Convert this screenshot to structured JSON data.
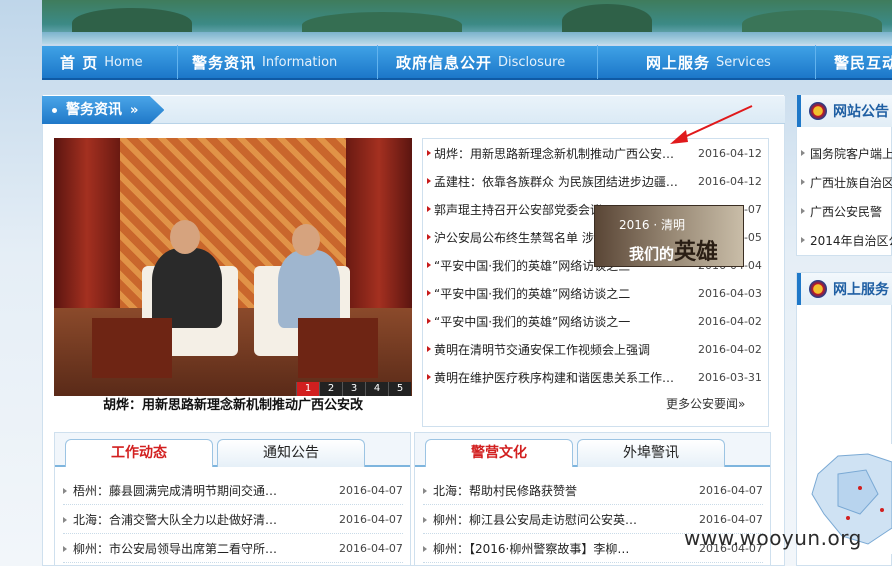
{
  "nav": {
    "items": [
      {
        "zh": "首 页",
        "en": "Home"
      },
      {
        "zh": "警务资讯",
        "en": "Information"
      },
      {
        "zh": "政府信息公开",
        "en": "Disclosure"
      },
      {
        "zh": "网上服务",
        "en": "Services"
      },
      {
        "zh": "警民互动",
        "en": ""
      }
    ]
  },
  "section": {
    "title": "警务资讯",
    "chevrons": "»"
  },
  "photo": {
    "caption": "胡烨：用新思路新理念新机制推动广西公安改",
    "pager": [
      "1",
      "2",
      "3",
      "4",
      "5"
    ],
    "active_page": "1"
  },
  "news": [
    {
      "title": "胡烨：用新思路新理念新机制推动广西公安…",
      "date": "2016-04-12"
    },
    {
      "title": "孟建柱：依靠各族群众 为民族团结进步边疆…",
      "date": "2016-04-12"
    },
    {
      "title": "郭声琨主持召开公安部党委会议",
      "date": "2016-04-07"
    },
    {
      "title": "沪公安局公布终生禁驾名单 涉",
      "date": "2016-04-05"
    },
    {
      "title": "“平安中国·我们的英雄”网络访谈之三",
      "date": "2016-04-04"
    },
    {
      "title": "“平安中国·我们的英雄”网络访谈之二",
      "date": "2016-04-03"
    },
    {
      "title": "“平安中国·我们的英雄”网络访谈之一",
      "date": "2016-04-02"
    },
    {
      "title": "黄明在清明节交通安保工作视频会上强调",
      "date": "2016-04-02"
    },
    {
      "title": "黄明在维护医疗秩序构建和谐医患关系工作…",
      "date": "2016-03-31"
    }
  ],
  "more_label": "更多公安要闻»",
  "promo": {
    "year": "2016 · 清明",
    "text_a": "我们的",
    "text_b": "英雄"
  },
  "panel_left": {
    "tabs": [
      "工作动态",
      "通知公告"
    ],
    "rows": [
      {
        "title": "梧州：藤县圆满完成清明节期间交通…",
        "date": "2016-04-07"
      },
      {
        "title": "北海：合浦交警大队全力以赴做好清…",
        "date": "2016-04-07"
      },
      {
        "title": "柳州：市公安局领导出席第二看守所…",
        "date": "2016-04-07"
      }
    ]
  },
  "panel_right": {
    "tabs": [
      "警营文化",
      "外埠警讯"
    ],
    "rows": [
      {
        "title": "北海：帮助村民修路获赞誉",
        "date": "2016-04-07"
      },
      {
        "title": "柳州：柳江县公安局走访慰问公安英…",
        "date": "2016-04-07"
      },
      {
        "title": "柳州：【2016·柳州警察故事】李柳…",
        "date": "2016-04-07"
      }
    ]
  },
  "sidebar": {
    "notice_title": "网站公告",
    "links": [
      "国务院客户端上",
      "广西壮族自治区",
      "广西公安民警",
      "2014年自治区公"
    ],
    "service_title": "网上服务"
  },
  "watermark": "www.wooyun.org",
  "colors": {
    "nav": "#1c77c9",
    "accent_red": "#d21f1f",
    "title_blue": "#1f5fa3"
  }
}
